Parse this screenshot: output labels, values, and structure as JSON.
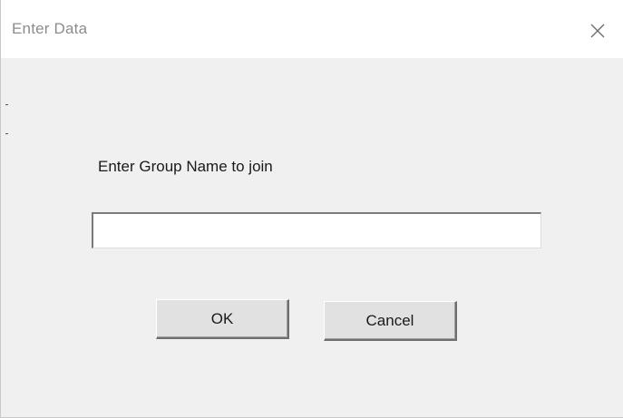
{
  "window": {
    "title": "Enter Data"
  },
  "prompt": {
    "label": "Enter Group Name to join"
  },
  "input": {
    "value": "",
    "placeholder": ""
  },
  "buttons": {
    "ok_label": "OK",
    "cancel_label": "Cancel"
  },
  "icons": {
    "close": "close-icon"
  },
  "colors": {
    "dialog_background": "#f0f0f0",
    "titlebar_background": "#ffffff",
    "title_text": "#8c8c8c",
    "button_face": "#e1e1e1"
  }
}
